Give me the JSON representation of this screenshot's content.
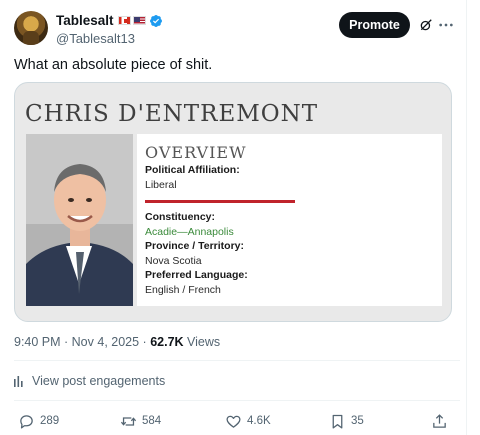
{
  "author": {
    "display_name": "Tablesalt",
    "handle": "@Tablesalt13",
    "flag_icons": [
      "canada-flag-icon",
      "us-flag-icon"
    ],
    "verified_icon": "verified-badge-icon",
    "verified_color": "#1d9bf0"
  },
  "header_actions": {
    "promote_label": "Promote",
    "grok_icon": "grok-icon",
    "more_icon": "more-icon"
  },
  "post": {
    "text": "What an absolute piece of shit."
  },
  "card": {
    "name": "CHRIS D'ENTREMONT",
    "overview_heading": "OVERVIEW",
    "affiliation_label": "Political Affiliation:",
    "affiliation_value": "Liberal",
    "constituency_label": "Constituency:",
    "constituency_value": "Acadie—Annapolis",
    "province_label": "Province / Territory:",
    "province_value": "Nova Scotia",
    "language_label": "Preferred Language:",
    "language_value": "English / French",
    "accent_color": "#c0232b",
    "link_color": "#3a8a3a"
  },
  "meta": {
    "timestamp": "9:40 PM · Nov 4, 2025 · ",
    "views_count": "62.7K",
    "views_label": " Views"
  },
  "engagements": {
    "label": "View post engagements",
    "icon": "analytics-icon"
  },
  "actions": {
    "replies": "289",
    "reposts": "584",
    "likes": "4.6K",
    "bookmarks": "35",
    "share_icon": "share-icon"
  }
}
